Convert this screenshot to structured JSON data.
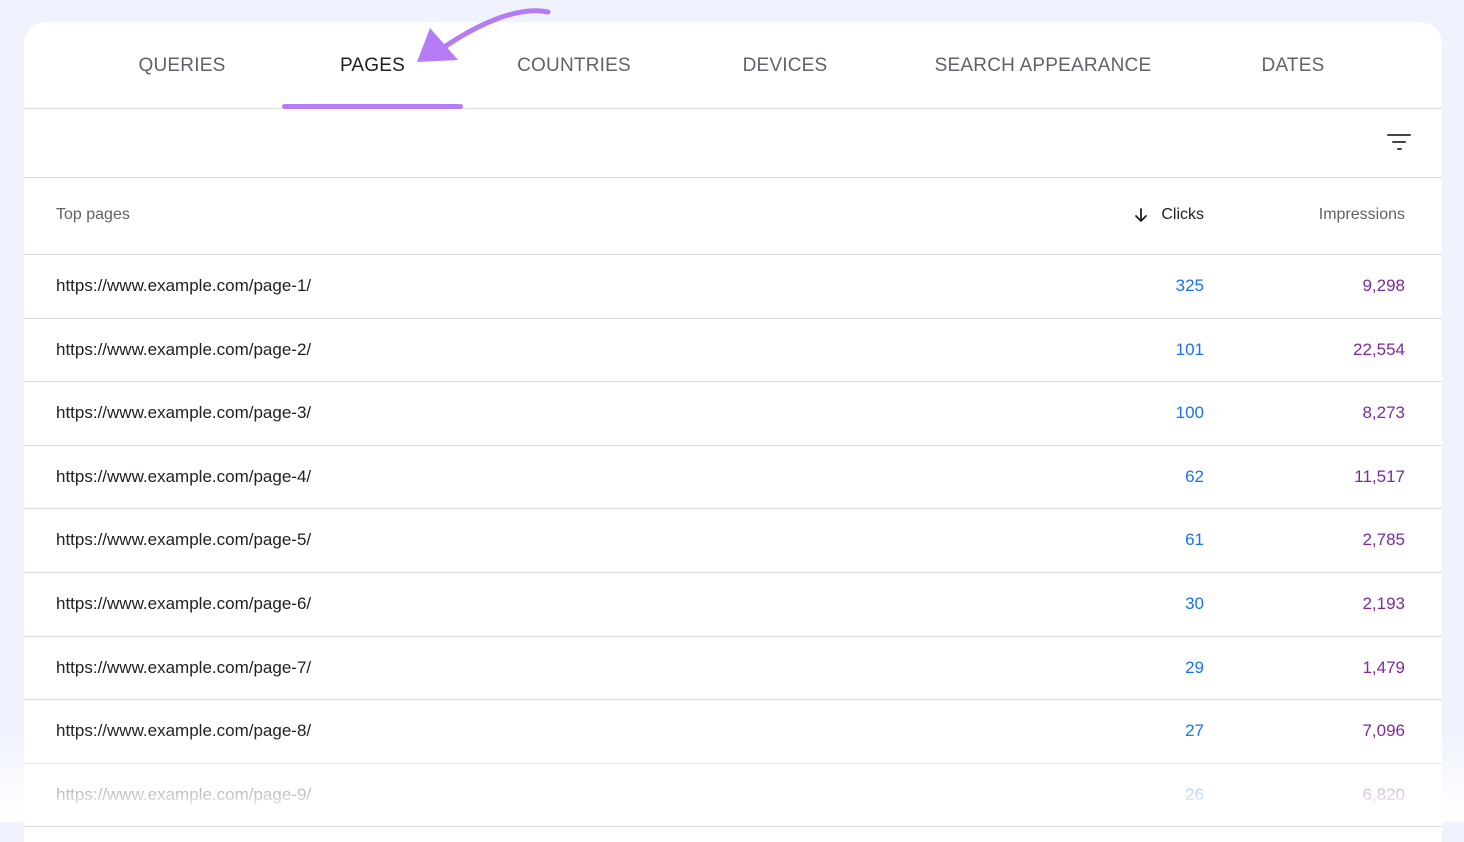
{
  "tabs": [
    {
      "label": "QUERIES"
    },
    {
      "label": "PAGES"
    },
    {
      "label": "COUNTRIES"
    },
    {
      "label": "DEVICES"
    },
    {
      "label": "SEARCH APPEARANCE"
    },
    {
      "label": "DATES"
    }
  ],
  "active_tab": "PAGES",
  "accent_color": "#b57cf6",
  "table": {
    "headers": {
      "page": "Top pages",
      "clicks": "Clicks",
      "impressions": "Impressions"
    },
    "sort_icon": "arrow-down-icon",
    "rows": [
      {
        "page": "https://www.example.com/page-1/",
        "clicks": "325",
        "impressions": "9,298"
      },
      {
        "page": "https://www.example.com/page-2/",
        "clicks": "101",
        "impressions": "22,554"
      },
      {
        "page": "https://www.example.com/page-3/",
        "clicks": "100",
        "impressions": "8,273"
      },
      {
        "page": "https://www.example.com/page-4/",
        "clicks": "62",
        "impressions": "11,517"
      },
      {
        "page": "https://www.example.com/page-5/",
        "clicks": "61",
        "impressions": "2,785"
      },
      {
        "page": "https://www.example.com/page-6/",
        "clicks": "30",
        "impressions": "2,193"
      },
      {
        "page": "https://www.example.com/page-7/",
        "clicks": "29",
        "impressions": "1,479"
      },
      {
        "page": "https://www.example.com/page-8/",
        "clicks": "27",
        "impressions": "7,096"
      },
      {
        "page": "https://www.example.com/page-9/",
        "clicks": "26",
        "impressions": "6,820"
      }
    ]
  },
  "toolbar": {
    "filter_icon": "filter-icon"
  },
  "annotation": {
    "icon": "arrow-pointer-icon",
    "color": "#b57cf6"
  }
}
